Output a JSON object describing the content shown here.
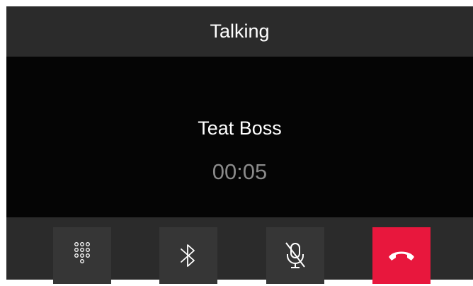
{
  "header": {
    "title": "Talking"
  },
  "call": {
    "caller_name": "Teat Boss",
    "duration": "00:05"
  },
  "controls": [
    {
      "icon": "dialpad-icon",
      "action": "dialpad"
    },
    {
      "icon": "bluetooth-icon",
      "action": "bluetooth"
    },
    {
      "icon": "mic-muted-icon",
      "action": "mute"
    },
    {
      "icon": "end-call-icon",
      "action": "hang-up"
    }
  ],
  "colors": {
    "end_call": "#e8173d",
    "background": "#050505",
    "panel": "#2b2b2b",
    "button": "#363636"
  }
}
